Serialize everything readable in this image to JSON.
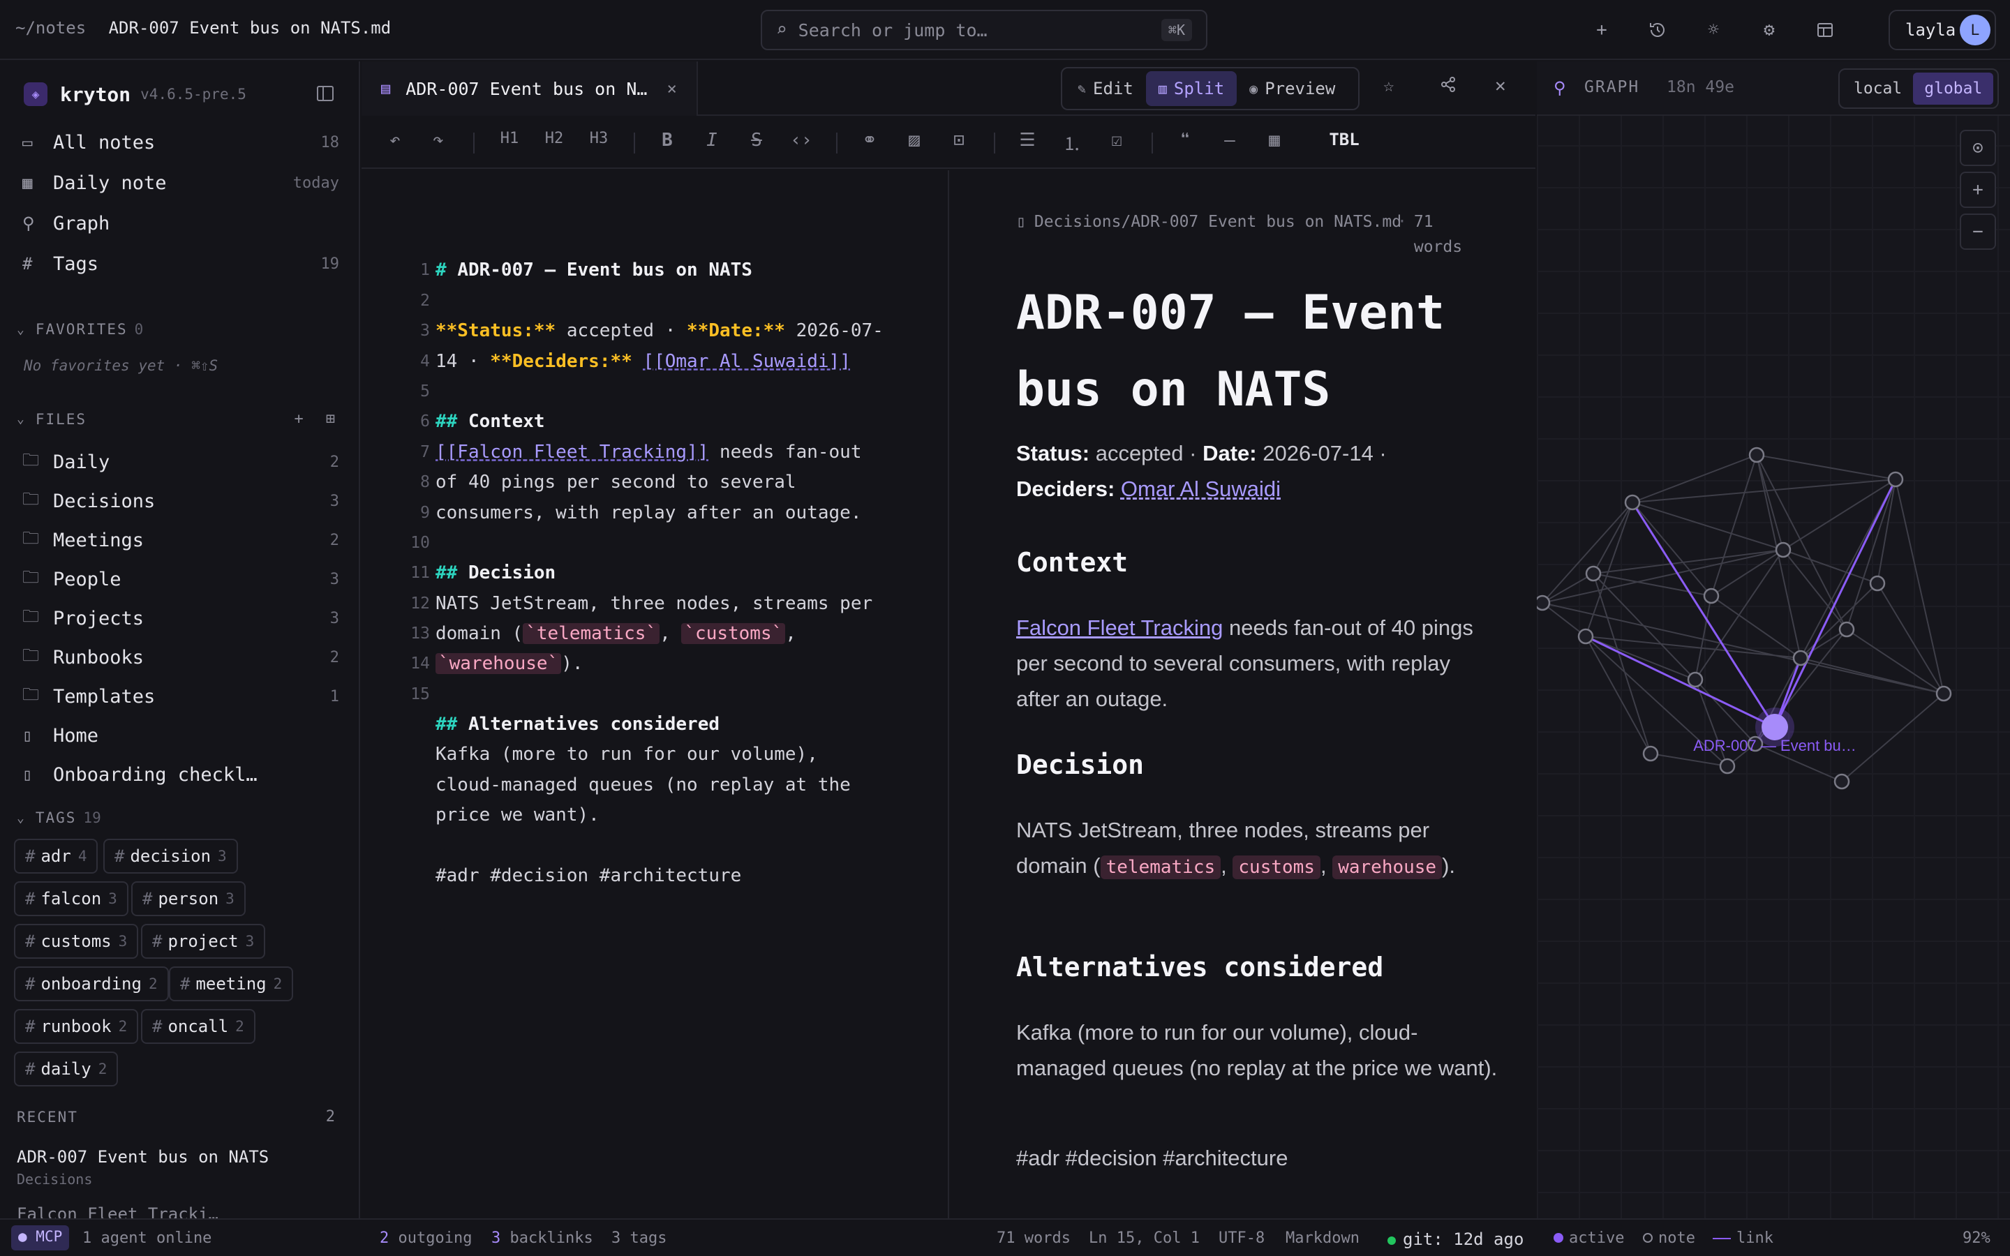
{
  "topbar": {
    "path": "~/notes",
    "file": "ADR-007 Event bus on NATS.md",
    "search_placeholder": "Search or jump to…",
    "search_shortcut": "⌘K",
    "user": "layla",
    "avatar_initial": "L"
  },
  "sidebar": {
    "brand": "kryton",
    "version": "v4.6.5-pre.5",
    "nav": [
      {
        "label": "All notes",
        "count": "18"
      },
      {
        "label": "Daily note",
        "count": "today"
      },
      {
        "label": "Graph",
        "count": ""
      },
      {
        "label": "Tags",
        "count": "19"
      }
    ],
    "favorites_label": "FAVORITES",
    "favorites_count": "0",
    "favorites_empty": "No favorites yet · ⌘⇧S",
    "files_label": "FILES",
    "folders": [
      {
        "label": "Daily",
        "count": "2"
      },
      {
        "label": "Decisions",
        "count": "3"
      },
      {
        "label": "Meetings",
        "count": "2"
      },
      {
        "label": "People",
        "count": "3"
      },
      {
        "label": "Projects",
        "count": "3"
      },
      {
        "label": "Runbooks",
        "count": "2"
      },
      {
        "label": "Templates",
        "count": "1"
      }
    ],
    "files": [
      {
        "label": "Home"
      },
      {
        "label": "Onboarding checkl…"
      }
    ],
    "tags_label": "TAGS",
    "tags_count": "19",
    "tags": [
      {
        "name": "adr",
        "count": "4"
      },
      {
        "name": "decision",
        "count": "3"
      },
      {
        "name": "falcon",
        "count": "3"
      },
      {
        "name": "person",
        "count": "3"
      },
      {
        "name": "customs",
        "count": "3"
      },
      {
        "name": "project",
        "count": "3"
      },
      {
        "name": "onboarding",
        "count": "2"
      },
      {
        "name": "meeting",
        "count": "2"
      },
      {
        "name": "runbook",
        "count": "2"
      },
      {
        "name": "oncall",
        "count": "2"
      },
      {
        "name": "daily",
        "count": "2"
      }
    ],
    "recent_label": "RECENT",
    "recent_count": "2",
    "recent": [
      {
        "title": "ADR-007 Event bus on NATS",
        "folder": "Decisions"
      },
      {
        "title": "Falcon Fleet Tracki…",
        "folder": ""
      }
    ]
  },
  "editor": {
    "tab_label": "ADR-007 Event bus on N…",
    "modes": {
      "edit": "Edit",
      "split": "Split",
      "preview": "Preview"
    },
    "toolbar": {
      "h1": "H1",
      "h2": "H2",
      "h3": "H3",
      "table_label": "TBL"
    },
    "line_numbers": [
      "1",
      "2",
      "3",
      "4",
      "5",
      "6",
      "7",
      "8",
      "9",
      "10",
      "11",
      "12",
      "13",
      "14",
      "15"
    ],
    "code": {
      "l1_marker": "#",
      "l1_text": "ADR-007 — Event bus on NATS",
      "status_key": "**Status:**",
      "status_val": "accepted ·",
      "date_key": "**Date:**",
      "date_val": "2026-07-",
      "date_cont": "14 ·",
      "deciders_key": "**Deciders:**",
      "deciders_link": "[[Omar Al Suwaidi]]",
      "ctx_marker": "##",
      "ctx_title": "Context",
      "ctx_link": "[[Falcon Fleet Tracking]]",
      "ctx_l1": "needs fan-out",
      "ctx_l2": "of 40 pings per second to several",
      "ctx_l3": "consumers, with replay after an outage.",
      "dec_marker": "##",
      "dec_title": "Decision",
      "dec_l1": "NATS JetStream, three nodes, streams per",
      "dec_l2a": "domain (",
      "code_telematics": "`telematics`",
      "comma": ",",
      "code_customs": "`customs`",
      "code_warehouse": "`warehouse`",
      "dec_end": ").",
      "alt_marker": "##",
      "alt_title": "Alternatives considered",
      "alt_l1": "Kafka (more to run for our volume),",
      "alt_l2": "cloud-managed queues (no replay at the",
      "alt_l3": "price we want).",
      "tags_line": "#adr #decision #architecture"
    }
  },
  "preview": {
    "path": "Decisions/ADR-007 Event bus on NATS.md",
    "words": "71 words",
    "title": "ADR-007 — Event bus on NATS",
    "status_key": "Status:",
    "status_val": "accepted ·",
    "date_key": "Date:",
    "date_val": "2026-07-14 ·",
    "deciders_key": "Deciders:",
    "deciders_link": "Omar Al Suwaidi",
    "context_heading": "Context",
    "context_link": "Falcon Fleet Tracking",
    "context_text": "needs fan-out of 40 pings per second to several consumers, with replay after an outage.",
    "decision_heading": "Decision",
    "decision_text": "NATS JetStream, three nodes, streams per domain (",
    "code_telematics": "telematics",
    "code_customs": "customs",
    "code_warehouse": "warehouse",
    "decision_end": ").",
    "alternatives_heading": "Alternatives considered",
    "alternatives_text": "Kafka (more to run for our volume), cloud-managed queues (no replay at the price we want).",
    "tags_line": "#adr #decision #architecture"
  },
  "graph": {
    "title": "GRAPH",
    "time": "18n 49e",
    "scope_local": "local",
    "scope_global": "global",
    "active_label": "ADR-007 — Event bu…",
    "accent": "#a78bfa"
  },
  "status": {
    "mcp": "MCP",
    "agents": "1 agent online",
    "outgoing_count": "2",
    "outgoing_label": "outgoing",
    "backlinks_count": "3",
    "backlinks_label": "backlinks",
    "tags": "3 tags",
    "words": "71 words",
    "position": "Ln 15, Col 1",
    "encoding": "UTF-8",
    "language": "Markdown",
    "git": "git: 12d ago",
    "legend_active": "active",
    "legend_note": "note",
    "legend_link": "link",
    "zoom": "92%"
  }
}
